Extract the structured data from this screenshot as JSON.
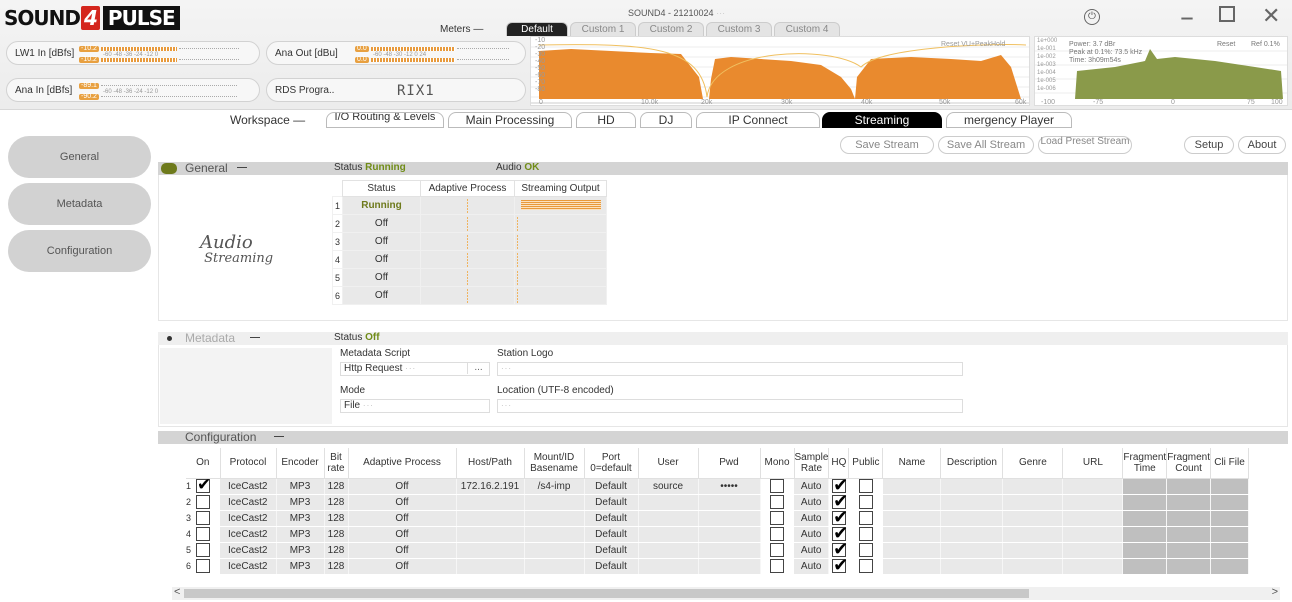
{
  "app": {
    "title": "SOUND4 - 21210024",
    "title_suffix": "···"
  },
  "meters": {
    "label": "Meters",
    "tabs": [
      "Default",
      "Custom 1",
      "Custom 2",
      "Custom 3",
      "Custom 4"
    ],
    "active_tab": "Default",
    "lw1_in": {
      "label": "LW1 In [dBfs]",
      "top": "-10.2",
      "bottom": "-10.2",
      "scale": "-60  -48  -36  -24  -12  0",
      "l": "L",
      "r": "R"
    },
    "ana_out": {
      "label": "Ana Out [dBu]",
      "top": "0.0",
      "bottom": "0.0",
      "scale": "-60  -48  -30  -12  0  24",
      "l": "L",
      "r": "R"
    },
    "ana_in": {
      "label": "Ana In [dBfs]",
      "top": "-89.1",
      "bottom": "-90.2",
      "scale": "-60  -48  -36  -24  -12  0",
      "l": "L",
      "r": "R"
    },
    "rds": {
      "label": "RDS Progra..",
      "value": "RIX1"
    },
    "spectrum": {
      "reset_label": "Reset VU+PeakHold",
      "x_ticks": [
        "0",
        "10.0k",
        "20k",
        "30k",
        "40k",
        "50k",
        "60k"
      ],
      "y_ticks": [
        "-10",
        "-20",
        "-30",
        "-40",
        "-50",
        "-60",
        "-70",
        "-80"
      ]
    },
    "power_spectrum": {
      "power": "Power: 3.7 dBr",
      "peak": "Peak at 0.1%: 73.5 kHz",
      "time": "Time: 3h09m54s",
      "reset_label": "Reset",
      "ref_label": "Ref 0.1%",
      "y_ticks": [
        "1e+000",
        "1e-001",
        "1e-002",
        "1e-003",
        "1e-004",
        "1e-005",
        "1e-006"
      ],
      "x_ticks": [
        "-100",
        "-75",
        "0",
        "75",
        "100"
      ]
    }
  },
  "workspace": {
    "label": "Workspace",
    "tabs": [
      "I/O Routing & Levels",
      "Main Processing",
      "HD",
      "DJ",
      "IP Connect",
      "Streaming",
      "mergency Player"
    ],
    "active_tab": "Streaming"
  },
  "toolbar": {
    "save_stream": "Save Stream",
    "save_all_stream": "Save All Stream",
    "load_preset_stream": "Load Preset Stream",
    "setup": "Setup",
    "about": "About"
  },
  "nav": {
    "items": [
      "General",
      "Metadata",
      "Configuration"
    ]
  },
  "general": {
    "title": "General",
    "status_label": "Status",
    "status_value": "Running",
    "audio_label": "Audio",
    "audio_value": "OK",
    "table": {
      "headers": [
        "Status",
        "Adaptive Process",
        "Streaming Output"
      ],
      "rows": [
        {
          "idx": "1",
          "status": "Running"
        },
        {
          "idx": "2",
          "status": "Off"
        },
        {
          "idx": "3",
          "status": "Off"
        },
        {
          "idx": "4",
          "status": "Off"
        },
        {
          "idx": "5",
          "status": "Off"
        },
        {
          "idx": "6",
          "status": "Off"
        }
      ]
    },
    "logo_line1": "Audio",
    "logo_line2": "Streaming"
  },
  "metadata": {
    "title": "Metadata",
    "status_label": "Status",
    "status_value": "Off",
    "script_label": "Metadata Script",
    "script_value": "Http Request",
    "script_browse": "...",
    "logo_label": "Station Logo",
    "mode_label": "Mode",
    "mode_value": "File",
    "location_label": "Location (UTF-8 encoded)",
    "placeholder": "···"
  },
  "configuration": {
    "title": "Configuration",
    "headers": [
      "On",
      "Protocol",
      "Encoder",
      "Bit rate",
      "Adaptive Process",
      "Host/Path",
      "Mount/ID Basename",
      "Port 0=default",
      "User",
      "Pwd",
      "Mono",
      "Sample Rate",
      "HQ",
      "Public",
      "Name",
      "Description",
      "Genre",
      "URL",
      "Fragment Time",
      "Fragment Count",
      "Cli File"
    ],
    "rows": [
      {
        "idx": "1",
        "on": true,
        "protocol": "IceCast2",
        "encoder": "MP3",
        "bitrate": "128",
        "adaptive": "Off",
        "host": "172.16.2.191",
        "mount": "/s4-imp",
        "port": "Default",
        "user": "source",
        "pwd": "•••••",
        "mono": false,
        "sample": "Auto",
        "hq": true,
        "public": false
      },
      {
        "idx": "2",
        "on": false,
        "protocol": "IceCast2",
        "encoder": "MP3",
        "bitrate": "128",
        "adaptive": "Off",
        "host": "",
        "mount": "",
        "port": "Default",
        "user": "",
        "pwd": "",
        "mono": false,
        "sample": "Auto",
        "hq": true,
        "public": false
      },
      {
        "idx": "3",
        "on": false,
        "protocol": "IceCast2",
        "encoder": "MP3",
        "bitrate": "128",
        "adaptive": "Off",
        "host": "",
        "mount": "",
        "port": "Default",
        "user": "",
        "pwd": "",
        "mono": false,
        "sample": "Auto",
        "hq": true,
        "public": false
      },
      {
        "idx": "4",
        "on": false,
        "protocol": "IceCast2",
        "encoder": "MP3",
        "bitrate": "128",
        "adaptive": "Off",
        "host": "",
        "mount": "",
        "port": "Default",
        "user": "",
        "pwd": "",
        "mono": false,
        "sample": "Auto",
        "hq": true,
        "public": false
      },
      {
        "idx": "5",
        "on": false,
        "protocol": "IceCast2",
        "encoder": "MP3",
        "bitrate": "128",
        "adaptive": "Off",
        "host": "",
        "mount": "",
        "port": "Default",
        "user": "",
        "pwd": "",
        "mono": false,
        "sample": "Auto",
        "hq": true,
        "public": false
      },
      {
        "idx": "6",
        "on": false,
        "protocol": "IceCast2",
        "encoder": "MP3",
        "bitrate": "128",
        "adaptive": "Off",
        "host": "",
        "mount": "",
        "port": "Default",
        "user": "",
        "pwd": "",
        "mono": false,
        "sample": "Auto",
        "hq": true,
        "public": false
      }
    ]
  },
  "logo": {
    "part1": "SOUND",
    "part2": "4",
    "part3": "PULSE"
  },
  "scrollbar": {
    "left_arrow": "<",
    "right_arrow": ">"
  },
  "colors": {
    "accent": "#6e7a1c",
    "meter_orange": "#e89a3c",
    "spectrum_green": "#8a9a4a"
  }
}
